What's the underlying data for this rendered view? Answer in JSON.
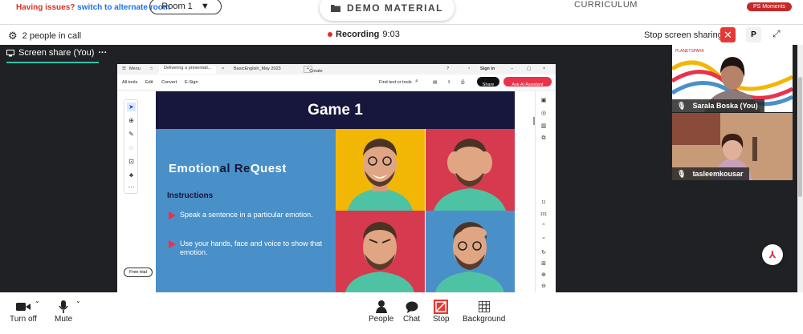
{
  "topbar": {
    "issues_text": "Having issues?",
    "issues_link": "switch to alternate room",
    "room_label": "Room 1",
    "demo_label": "DEMO MATERIAL",
    "curriculum_label": "CURRICULUM",
    "ps_moments_label": "PS Moments"
  },
  "callbar": {
    "people_count": "2 people in call",
    "recording_label": "Recording",
    "recording_time": "9:03",
    "stop_share_label": "Stop screen sharing",
    "p_label": "P"
  },
  "stage": {
    "share_tab_label": "Screen share (You)"
  },
  "browser": {
    "menu_label": "Menu",
    "tab1": "Delivering a presentati...",
    "tab2": "BasicEnglish_May 2023",
    "new_tab": "Create",
    "sign_in": "Sign in",
    "toolbar": [
      "All tools",
      "Edit",
      "Convert",
      "E-Sign"
    ],
    "find_label": "Find text or tools",
    "share_label": "Share",
    "ai_label": "Ask AI Assistant",
    "free_trial": "Free trial",
    "page_num": "11",
    "page_total": "101"
  },
  "slide": {
    "title": "Game 1",
    "emo_part1": "Emotion",
    "emo_part2": "al ",
    "emo_part3": "Re",
    "emo_part4": "Quest",
    "instructions_heading": "Instructions",
    "bullets": [
      "Speak a sentence in a particular emotion.",
      "Use your hands, face and voice to show that emotion."
    ]
  },
  "participants": [
    {
      "name": "Sarala Boska (You)"
    },
    {
      "name": "tasleemkousar"
    }
  ],
  "bottombar": {
    "camera_label": "Turn off",
    "mic_label": "Mute",
    "people_label": "People",
    "chat_label": "Chat",
    "stop_label": "Stop",
    "background_label": "Background"
  },
  "colors": {
    "accent_red": "#e53935",
    "slide_navy": "#17163c",
    "slide_blue": "#4a90c8",
    "slide_yellow": "#f2b705",
    "slide_pink": "#d63a4f",
    "teal": "#2ec4a6"
  }
}
